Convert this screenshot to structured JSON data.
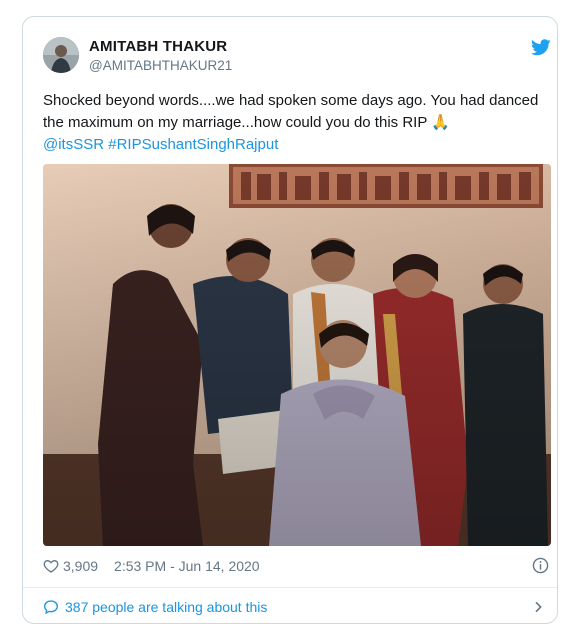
{
  "tweet": {
    "author_name": "AMITABH THAKUR",
    "author_handle": "@AMITABHTHAKUR21",
    "text_main": "Shocked beyond words....we had spoken some days ago. You had danced the maximum on my marriage...how could you do this RIP 🙏",
    "mention": "@itsSSR",
    "hashtag": "#RIPSushantSinghRajput",
    "likes": "3,909",
    "timestamp": "2:53 PM - Jun 14, 2020",
    "talking": "387 people are talking about this"
  },
  "icons": {
    "brand": "twitter-bird-icon",
    "like": "heart-icon",
    "info": "info-icon",
    "conversation": "chat-bubble-icon",
    "chevron": "chevron-right-icon"
  },
  "colors": {
    "link": "#1b95e0",
    "muted": "#657786",
    "border": "#cfd9de"
  }
}
